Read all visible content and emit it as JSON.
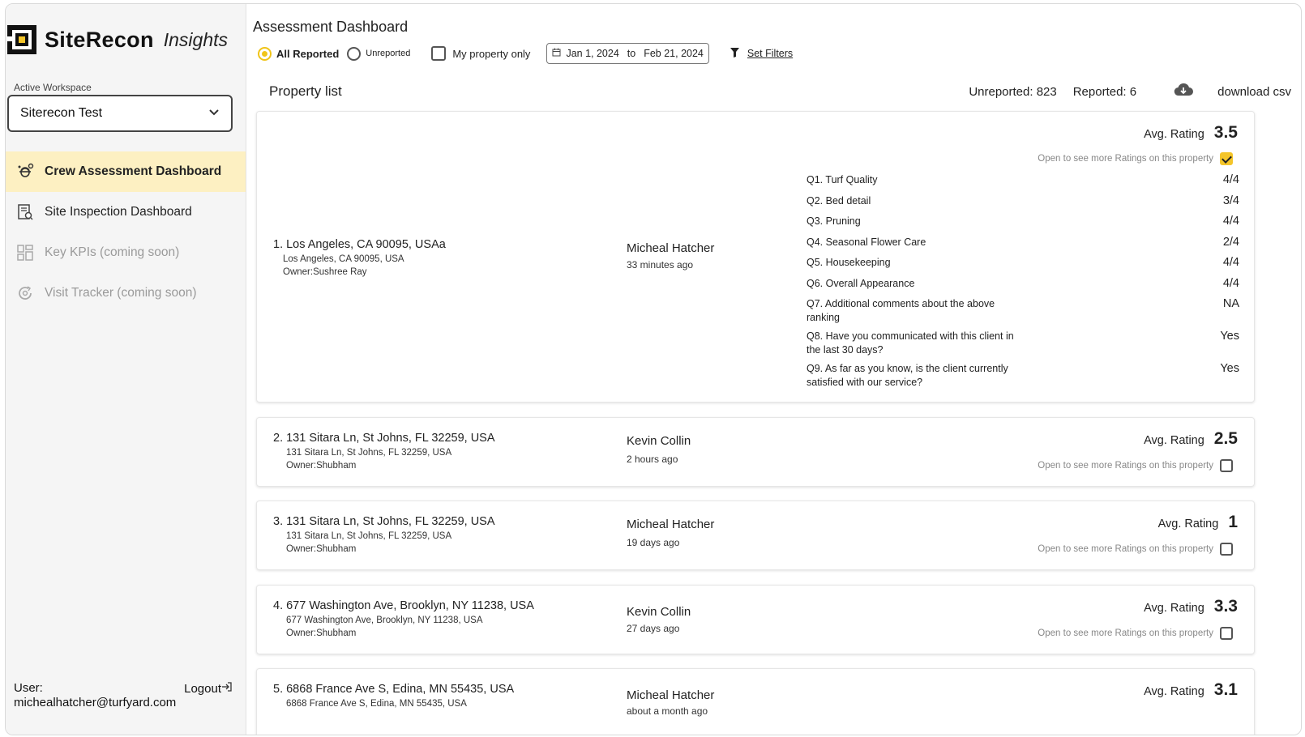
{
  "brand": {
    "name": "SiteRecon",
    "sub": "Insights"
  },
  "workspace": {
    "label": "Active Workspace",
    "value": "Siterecon Test"
  },
  "nav": [
    {
      "label": "Crew Assessment Dashboard",
      "icon": "crew-icon",
      "active": true
    },
    {
      "label": "Site Inspection Dashboard",
      "icon": "inspection-icon"
    },
    {
      "label": "Key KPIs (coming soon)",
      "icon": "grid-icon",
      "disabled": true
    },
    {
      "label": "Visit Tracker (coming soon)",
      "icon": "tracker-icon",
      "disabled": true
    }
  ],
  "user": {
    "label": "User:",
    "email": "michealhatcher@turfyard.com",
    "logout": "Logout"
  },
  "header": {
    "title": "Assessment Dashboard",
    "radio_all": "All Reported",
    "radio_unreported": "Unreported",
    "my_property": "My property only",
    "date_from": "Jan 1, 2024",
    "date_to_label": "to",
    "date_to": "Feb 21, 2024",
    "set_filters": "Set Filters"
  },
  "list": {
    "title": "Property list",
    "unreported": "Unreported: 823",
    "reported": "Reported: 6",
    "download": "download csv"
  },
  "avg_label": "Avg. Rating",
  "open_label": "Open to see more Ratings on this property",
  "properties": [
    {
      "title": "1. Los Angeles, CA 90095, USAa",
      "address": "Los Angeles, CA 90095, USA",
      "owner": "Owner:Sushree Ray",
      "crew": "Micheal Hatcher",
      "time": "33 minutes ago",
      "avg": "3.5",
      "expanded": true,
      "questions": [
        {
          "q": "Q1. Turf Quality",
          "a": "4/4"
        },
        {
          "q": "Q2. Bed detail",
          "a": "3/4"
        },
        {
          "q": "Q3. Pruning",
          "a": "4/4"
        },
        {
          "q": "Q4. Seasonal Flower Care",
          "a": "2/4"
        },
        {
          "q": "Q5. Housekeeping",
          "a": "4/4"
        },
        {
          "q": "Q6. Overall Appearance",
          "a": "4/4"
        },
        {
          "q": "Q7. Additional comments about the above ranking",
          "a": "NA"
        },
        {
          "q": "Q8. Have you communicated with this client in the last 30 days?",
          "a": "Yes"
        },
        {
          "q": "Q9. As far as you know, is the client currently satisfied with our service?",
          "a": "Yes"
        }
      ]
    },
    {
      "title": "2. 131 Sitara Ln, St Johns, FL 32259, USA",
      "address": "131 Sitara Ln, St Johns, FL 32259, USA",
      "owner": "Owner:Shubham",
      "crew": "Kevin Collin",
      "time": "2 hours ago",
      "avg": "2.5"
    },
    {
      "title": "3. 131 Sitara Ln, St Johns, FL 32259, USA",
      "address": "131 Sitara Ln, St Johns, FL 32259, USA",
      "owner": "Owner:Shubham",
      "crew": "Micheal Hatcher",
      "time": "19 days ago",
      "avg": "1"
    },
    {
      "title": "4. 677 Washington Ave, Brooklyn, NY 11238, USA",
      "address": "677 Washington Ave, Brooklyn, NY 11238, USA",
      "owner": "Owner:Shubham",
      "crew": "Kevin Collin",
      "time": "27 days ago",
      "avg": "3.3"
    },
    {
      "title": "5. 6868 France Ave S, Edina, MN 55435, USA",
      "address": "6868 France Ave S, Edina, MN 55435, USA",
      "owner": "",
      "crew": "Micheal Hatcher",
      "time": "about a month ago",
      "avg": "3.1"
    }
  ],
  "colors": {
    "accent": "#f4c52a",
    "active_bg": "#fdf0c2"
  }
}
